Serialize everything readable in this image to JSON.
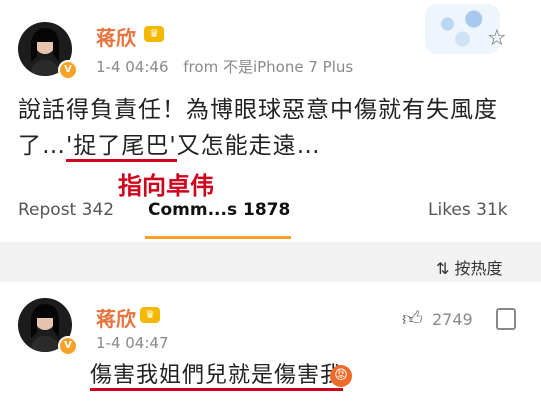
{
  "post": {
    "author": "蒋欣",
    "crown_icon": "crown-icon",
    "timestamp": "1-4 04:46",
    "source": "from 不是iPhone 7 Plus",
    "text_line1": "說話得負責任！為博眼球惡意中傷就有失風度",
    "text_line2_pre": "了…",
    "text_line2_highlight": "'捉了尾巴'",
    "text_line2_post": "又怎能走遠…",
    "annotation": "指向卓伟",
    "repost_label": "Repost 342",
    "comments_label": "Comm...s 1878",
    "likes_label": "Likes 31k"
  },
  "sort": {
    "icon": "sort-icon",
    "label": "按热度"
  },
  "comment": {
    "author": "蒋欣",
    "timestamp": "1-4 04:47",
    "like_count": "2749",
    "text": "傷害我姐們兒就是傷害我",
    "emoji": "angry-face-icon"
  },
  "colors": {
    "name": "#e8733c",
    "annotation_red": "#d0021b",
    "tab_underline": "#f59e2a",
    "badge": "#f7a224"
  }
}
